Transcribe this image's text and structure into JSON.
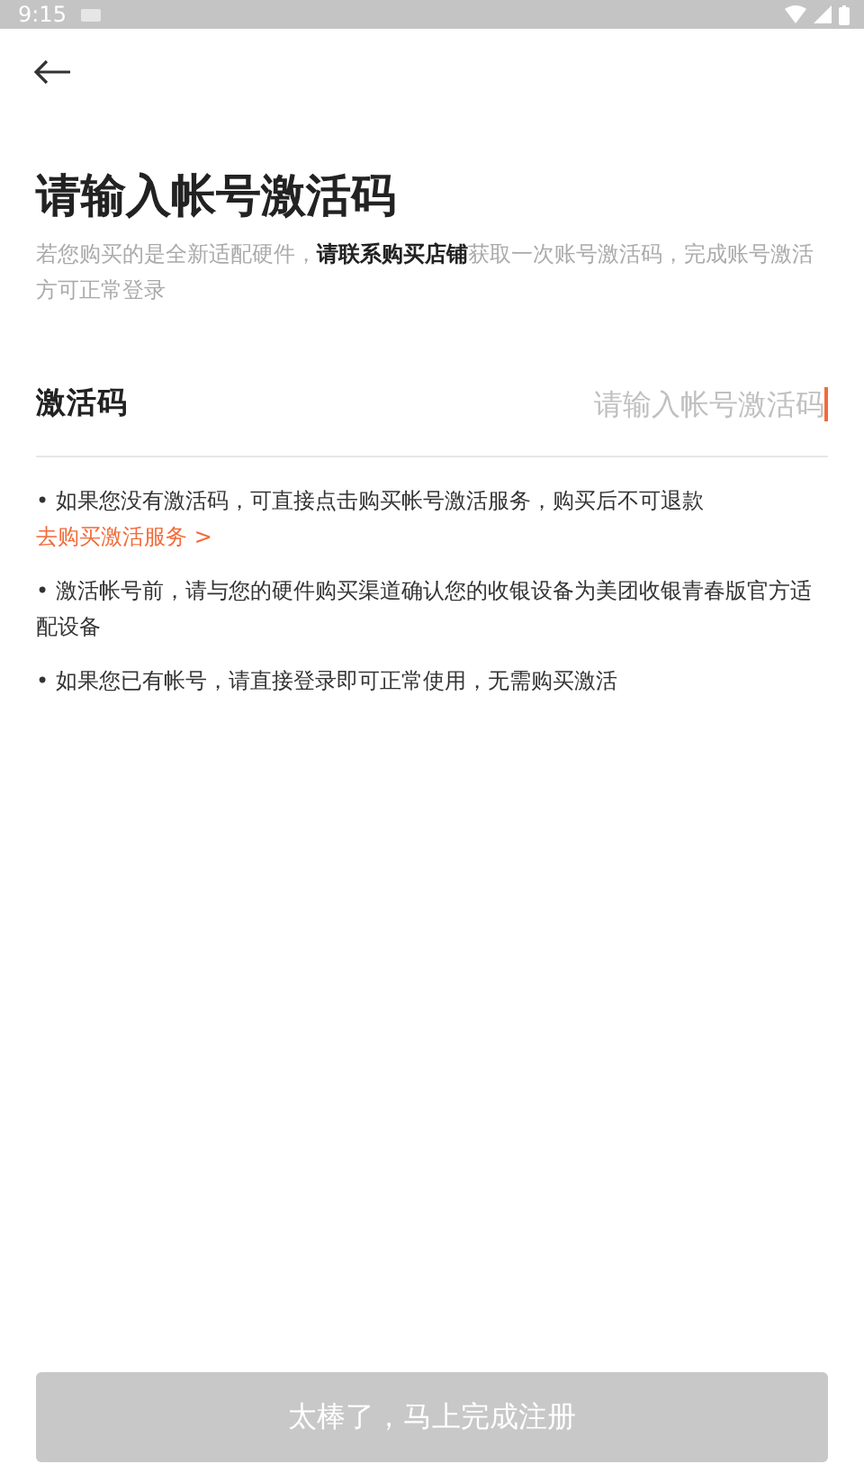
{
  "status_bar": {
    "time": "9:15"
  },
  "title": "请输入帐号激活码",
  "subtitle": "若您购买的是全新适配硬件，**请联系购买店铺**获取一次账号激活码，完成账号激活方可正常登录",
  "field": {
    "label": "激活码",
    "placeholder": "请输入帐号激活码",
    "focused": true
  },
  "notes": [
    {
      "text": "• 如果您没有激活码，可直接点击购买帐号激活服务，购买后不可退款",
      "link": "去购买激活服务 >"
    },
    {
      "text": "• 激活帐号前，请与您的硬件购买渠道确认您的收银设备为美团收银青春版官方适配设备"
    },
    {
      "text": "• 如果您已有帐号，请直接登录即可正常使用，无需购买激活"
    }
  ],
  "submit_button": {
    "label": "太棒了，马上完成注册",
    "disabled": true
  }
}
